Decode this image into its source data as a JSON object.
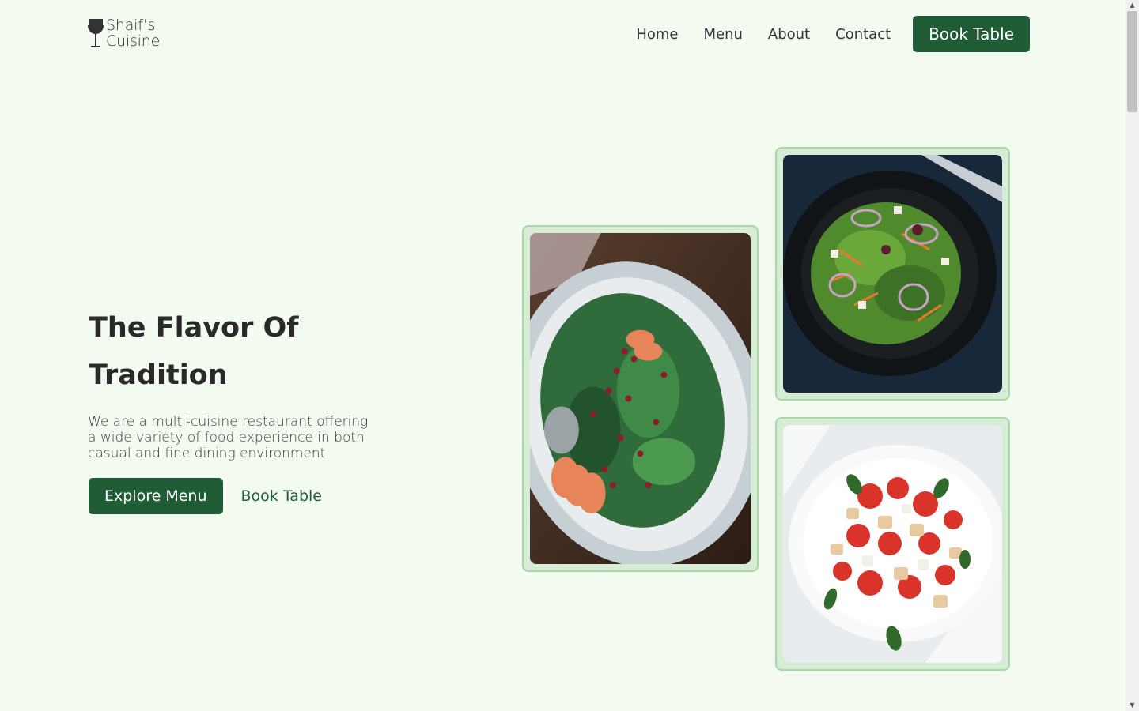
{
  "brand": {
    "line1": "Shaif’s",
    "line2": "Cuisine",
    "icon": "wine-glass-icon"
  },
  "nav": {
    "links": [
      "Home",
      "Menu",
      "About",
      "Contact"
    ],
    "cta": "Book Table"
  },
  "hero": {
    "title_line1": "The Flavor Of",
    "title_line2": "Tradition",
    "description": "We are a multi-cuisine restaurant offering a wide variety of food experience in both casual and fine dining environment.",
    "primary_button": "Explore Menu",
    "secondary_button": "Book Table"
  },
  "gallery": [
    {
      "alt": "spinach-pomegranate-salad-image"
    },
    {
      "alt": "mixed-green-salad-image"
    },
    {
      "alt": "tomato-bread-salad-image"
    }
  ],
  "colors": {
    "background": "#f3fbf1",
    "brand_green": "#1f5c35",
    "card_border": "#a9d8a6"
  }
}
